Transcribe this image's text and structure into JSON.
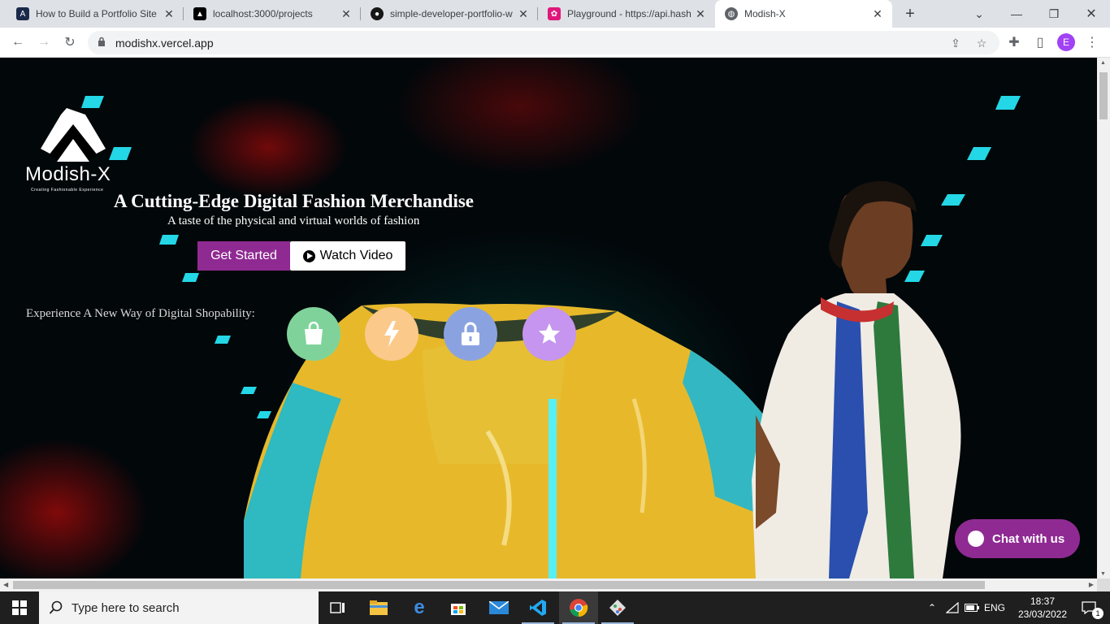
{
  "browser": {
    "tabs": [
      {
        "title": "How to Build a Portfolio Site",
        "favicon": "A",
        "fav_color": "#1b2a4a"
      },
      {
        "title": "localhost:3000/projects",
        "favicon": "▲",
        "fav_color": "#000000"
      },
      {
        "title": "simple-developer-portfolio-w",
        "favicon": "●",
        "fav_color": "#181717"
      },
      {
        "title": "Playground - https://api.hash",
        "favicon": "✿",
        "fav_color": "#e0177b"
      },
      {
        "title": "Modish-X",
        "favicon": "◍",
        "fav_color": "#5f6368",
        "active": true
      }
    ],
    "new_tab": "+",
    "url": "modishx.vercel.app",
    "profile_initial": "E"
  },
  "page": {
    "logo_text": "Modish-X",
    "logo_tagline": "Creating Fashionable Experience",
    "hero_title": "A Cutting-Edge Digital Fashion Merchandise",
    "hero_subtitle": "A taste of the physical and virtual worlds of fashion",
    "get_started_label": "Get Started",
    "watch_video_label": "Watch Video",
    "experience_label": "Experience A New Way of Digital Shopability:",
    "features": [
      {
        "icon": "shopping-bag-icon",
        "color": "#7fd39a"
      },
      {
        "icon": "lightning-icon",
        "color": "#fbc98a"
      },
      {
        "icon": "lock-icon",
        "color": "#8aa3e0"
      },
      {
        "icon": "star-icon",
        "color": "#c595ef"
      }
    ],
    "chat_label": "Chat with us",
    "accent_color": "#8f2a92"
  },
  "taskbar": {
    "search_placeholder": "Type here to search",
    "language": "ENG",
    "time": "18:37",
    "date": "23/03/2022",
    "notification_count": "1"
  }
}
